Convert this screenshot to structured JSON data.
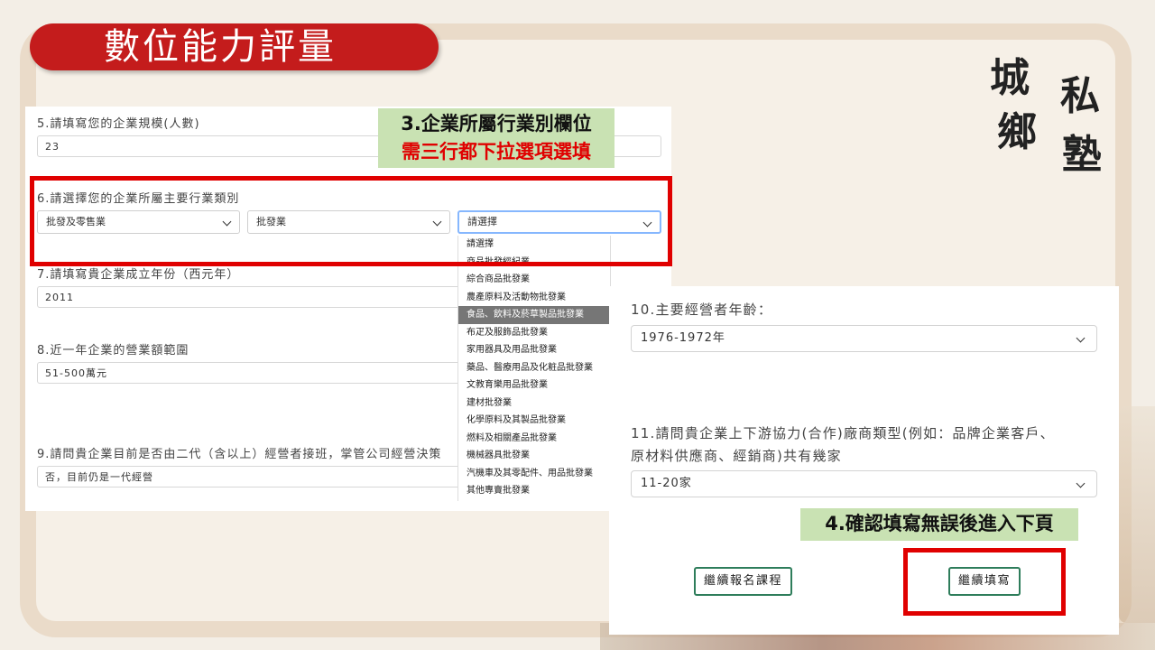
{
  "slide": {
    "title": "數位能力評量",
    "logo_chars": [
      "城",
      "鄉",
      "私",
      "塾"
    ]
  },
  "form_left": {
    "q5": {
      "label": "5.請填寫您的企業規模(人數)",
      "value": "23"
    },
    "q6": {
      "label": "6.請選擇您的企業所屬主要行業類別",
      "select1": "批發及零售業",
      "select2": "批發業",
      "select3": "請選擇"
    },
    "q7": {
      "label": "7.請填寫貴企業成立年份（西元年）",
      "value": "2011"
    },
    "q8": {
      "label": "8.近一年企業的營業額範圍",
      "value": "51-500萬元"
    },
    "q9": {
      "label": "9.請問貴企業目前是否由二代（含以上）經營者接班，掌管公司經營決策",
      "value": "否，目前仍是一代經營"
    }
  },
  "dropdown": {
    "items": [
      "請選擇",
      "商品批發經紀業",
      "綜合商品批發業",
      "農產原料及活動物批發業",
      "食品、飲料及菸草製品批發業",
      "布疋及服飾品批發業",
      "家用器具及用品批發業",
      "藥品、醫療用品及化粧品批發業",
      "文教育樂用品批發業",
      "建材批發業",
      "化學原料及其製品批發業",
      "燃料及相關產品批發業",
      "機械器具批發業",
      "汽機車及其零配件、用品批發業",
      "其他專賣批發業"
    ],
    "selected_index": 4
  },
  "annotations": {
    "step3_line1": "3.企業所屬行業別欄位",
    "step3_line2": "需三行都下拉選項選填",
    "step4": "4.確認填寫無誤後進入下頁"
  },
  "form_right": {
    "q10": {
      "label": "10.主要經營者年齡：",
      "value": "1976-1972年"
    },
    "q11": {
      "label_line1": "11.請問貴企業上下游協力(合作)廠商類型(例如：品牌企業客戶、",
      "label_line2": "原材料供應商、經銷商)共有幾家",
      "value": "11-20家"
    },
    "buttons": {
      "continue_register": "繼續報名課程",
      "continue_fill": "繼續填寫"
    }
  },
  "colors": {
    "title_bg": "#c41c1c",
    "highlight_red": "#e00000",
    "annotation_bg": "#c9e2b3",
    "button_border": "#2e7d5b",
    "focus_border": "#86b7fe"
  }
}
